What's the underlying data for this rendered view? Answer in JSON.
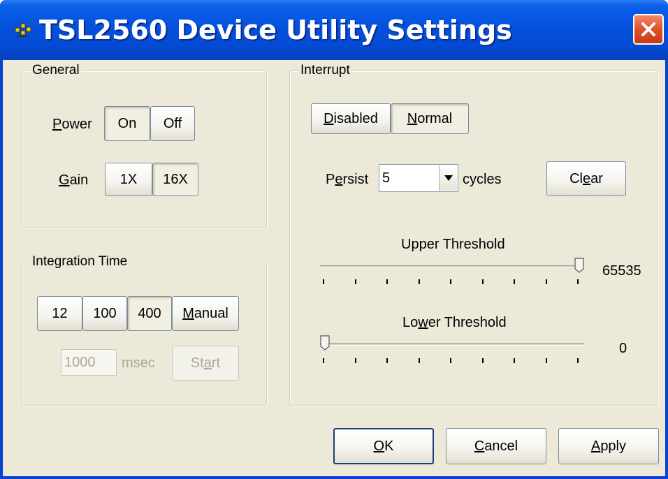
{
  "window": {
    "title": "TSL2560 Device Utility Settings",
    "icons": {
      "app": "app-icon",
      "close": "close-icon"
    }
  },
  "general": {
    "title": "General",
    "power": {
      "label": "Power",
      "on": "On",
      "off": "Off",
      "selected": "On"
    },
    "gain": {
      "label": "Gain",
      "x1": "1X",
      "x16": "16X",
      "selected": "16X"
    }
  },
  "integration": {
    "title": "Integration Time",
    "options": [
      "12",
      "100",
      "400",
      "Manual"
    ],
    "selected": "400",
    "msec_value": "1000",
    "msec_label": "msec",
    "start_label": "Start"
  },
  "interrupt": {
    "title": "Interrupt",
    "disabled_label": "Disabled",
    "normal_label": "Normal",
    "selected": "Normal",
    "persist_label": "Persist",
    "persist_value": "5",
    "cycles_label": "cycles",
    "clear_label": "Clear",
    "upper": {
      "label": "Upper Threshold",
      "value": "65535",
      "fraction": 1.0
    },
    "lower": {
      "label": "Lower Threshold",
      "value": "0",
      "fraction": 0.0
    }
  },
  "footer": {
    "ok": "OK",
    "cancel": "Cancel",
    "apply": "Apply"
  },
  "colors": {
    "titlebar": "#0451dd",
    "client": "#ece9d8",
    "close": "#e0502a"
  }
}
